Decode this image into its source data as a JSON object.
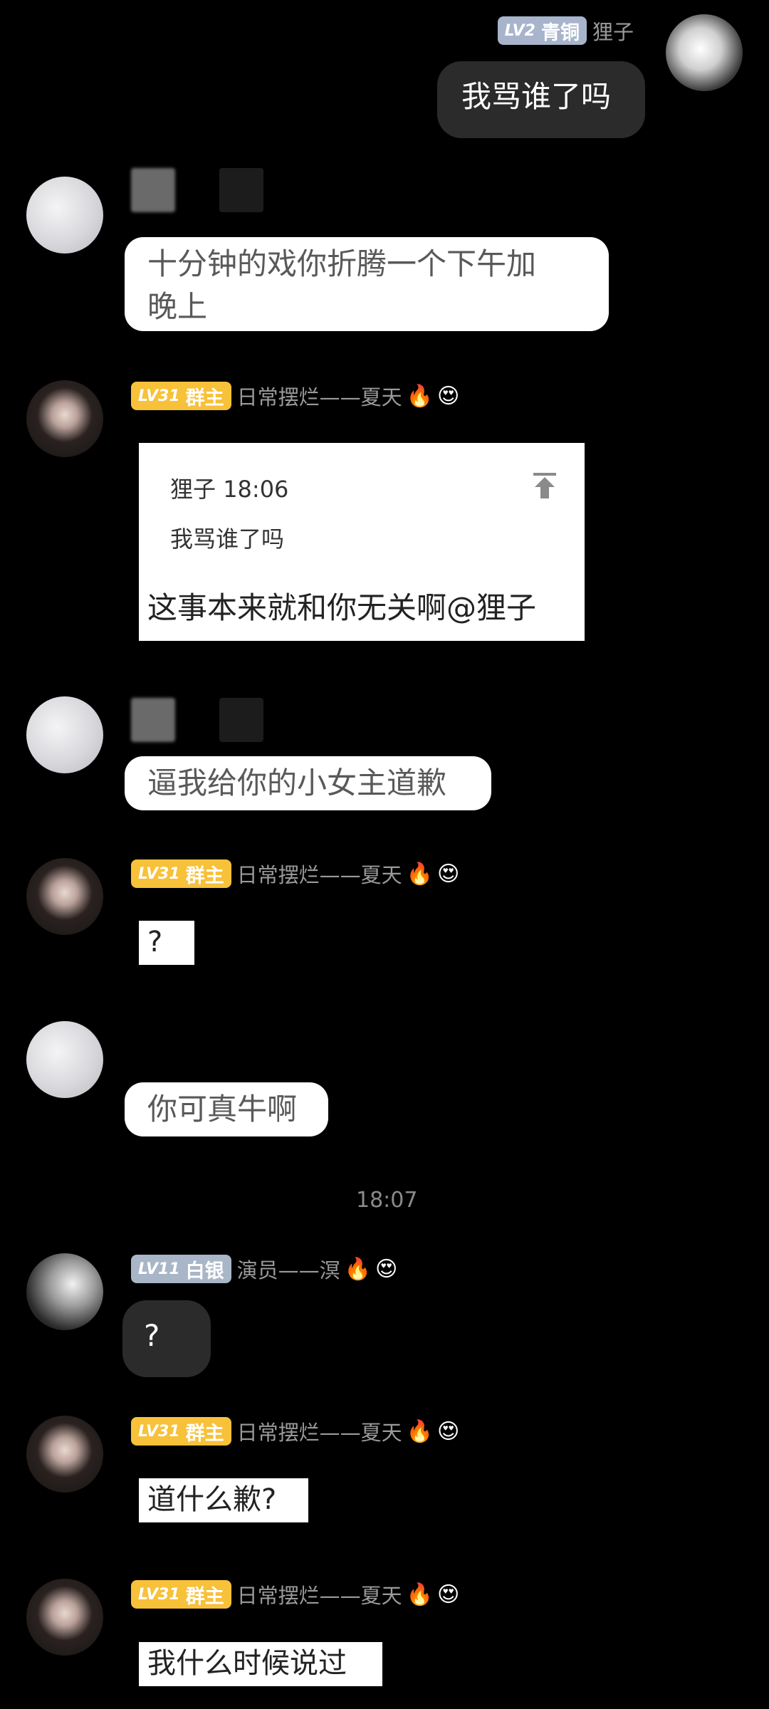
{
  "messages": {
    "m1": {
      "badge_level": "LV2",
      "badge_title": "青铜",
      "sender": "狸子",
      "text": "我骂谁了吗",
      "avatar": "manga-sketch-avatar"
    },
    "m2": {
      "text_line1": "十分钟的戏你折腾一个下午加",
      "text_line2": "晚上",
      "avatar": "sketch-face-avatar"
    },
    "m3": {
      "badge_level": "LV31",
      "badge_title": "群主",
      "sender": "日常摆烂——夏天",
      "emoji1": "🔥",
      "emoji2": "😍",
      "quote_sender": "狸子",
      "quote_time": "18:06",
      "quote_text": "我骂谁了吗",
      "text": "这事本来就和你无关啊@狸子",
      "avatar": "girl-photo-avatar"
    },
    "m4": {
      "text": "逼我给你的小女主道歉",
      "avatar": "sketch-face-avatar"
    },
    "m5": {
      "badge_level": "LV31",
      "badge_title": "群主",
      "sender": "日常摆烂——夏天",
      "emoji1": "🔥",
      "emoji2": "😍",
      "text": "?",
      "avatar": "girl-photo-avatar"
    },
    "m6": {
      "text": "你可真牛啊",
      "avatar": "sketch-face-avatar"
    },
    "time_divider": "18:07",
    "m7": {
      "badge_level": "LV11",
      "badge_title": "白银",
      "sender": "演员——溟",
      "emoji1": "🔥",
      "emoji2": "😍",
      "text": "?",
      "avatar": "ink-portrait-avatar"
    },
    "m8": {
      "badge_level": "LV31",
      "badge_title": "群主",
      "sender": "日常摆烂——夏天",
      "emoji1": "🔥",
      "emoji2": "😍",
      "text": "道什么歉?",
      "avatar": "girl-photo-avatar"
    },
    "m9": {
      "badge_level": "LV31",
      "badge_title": "群主",
      "sender": "日常摆烂——夏天",
      "emoji1": "🔥",
      "emoji2": "😍",
      "text": "我什么时候说过",
      "avatar": "girl-photo-avatar"
    }
  },
  "colors": {
    "background": "#000000",
    "gold_badge": "#f7c13a",
    "silver_badge": "#a9b6c8",
    "dark_bubble": "#2b2b2b",
    "white_bubble": "#ffffff"
  }
}
